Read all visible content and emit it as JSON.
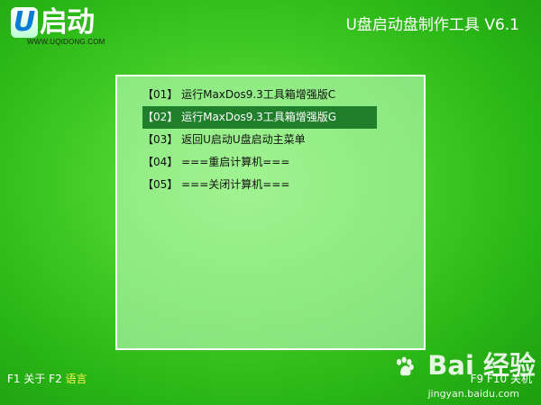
{
  "brand": {
    "logo_u": "U",
    "logo_text": "启动",
    "logo_sub": "WWW.UQIDONG.COM"
  },
  "header": {
    "title": "U盘启动盘制作工具 V6.1"
  },
  "menu": {
    "items": [
      {
        "label": "【01】 运行MaxDos9.3工具箱增强版C",
        "selected": false
      },
      {
        "label": "【02】 运行MaxDos9.3工具箱增强版G",
        "selected": true
      },
      {
        "label": "【03】 返回U启动U盘启动主菜单",
        "selected": false
      },
      {
        "label": "【04】 ===重启计算机===",
        "selected": false
      },
      {
        "label": "【05】 ===关闭计算机===",
        "selected": false
      }
    ]
  },
  "footer": {
    "left_hotkeys": "F1 关于  F2 ",
    "language": "语言",
    "right_hotkeys": "F9  F10 关机"
  },
  "watermark": {
    "main": "Bai  经验",
    "sub": "jingyan.baidu.com"
  },
  "colors": {
    "background": "#47cf2a",
    "panel": "#c4ffc4",
    "selected_row": "#1f7f2a",
    "hotkey_highlight": "#fff04d"
  },
  "icons": {
    "watermark": "paw-icon"
  }
}
